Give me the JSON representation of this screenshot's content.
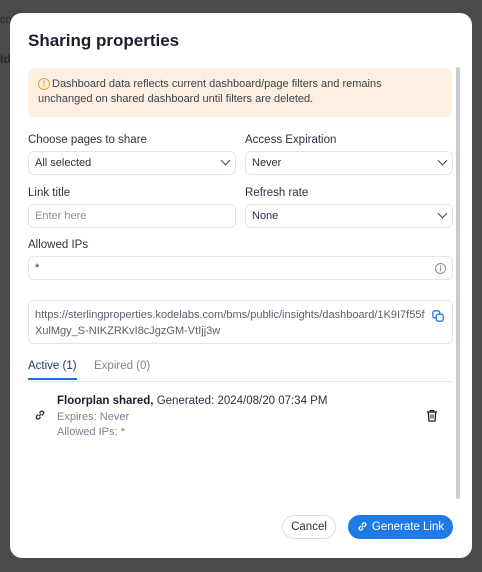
{
  "backdrop": {
    "text1": "co",
    "text2": "Id"
  },
  "modal": {
    "title": "Sharing properties",
    "alert": {
      "icon": "warning-circle-icon",
      "text_line1": "Dashboard data reflects current dashboard/page filters and remains",
      "text_line2": "unchanged on shared dashboard until filters are deleted."
    },
    "fields": {
      "pages_label": "Choose pages to share",
      "pages_value": "All selected",
      "expiration_label": "Access Expiration",
      "expiration_value": "Never",
      "link_title_label": "Link title",
      "link_title_placeholder": "Enter here",
      "refresh_label": "Refresh rate",
      "refresh_value": "None",
      "ips_label": "Allowed IPs",
      "ips_value": "*"
    },
    "url": "https://sterlingproperties.kodelabs.com/bms/public/insights/dashboard/1K9I7f55fXulMgy_S-NIKZRKvI8cJgzGM-VtIjj3w",
    "tabs": [
      {
        "label": "Active (1)"
      },
      {
        "label": "Expired (0)"
      }
    ],
    "share_item": {
      "name": "Floorplan shared,",
      "generated": "Generated: 2024/08/20 07:34 PM",
      "expires": "Expires: Never",
      "allowed_ips": "Allowed IPs: *"
    },
    "buttons": {
      "cancel": "Cancel",
      "generate": "Generate Link"
    }
  },
  "colors": {
    "accent": "#1f7ae8",
    "alert_bg": "#fdf0e1",
    "alert_icon": "#e6a23c"
  }
}
